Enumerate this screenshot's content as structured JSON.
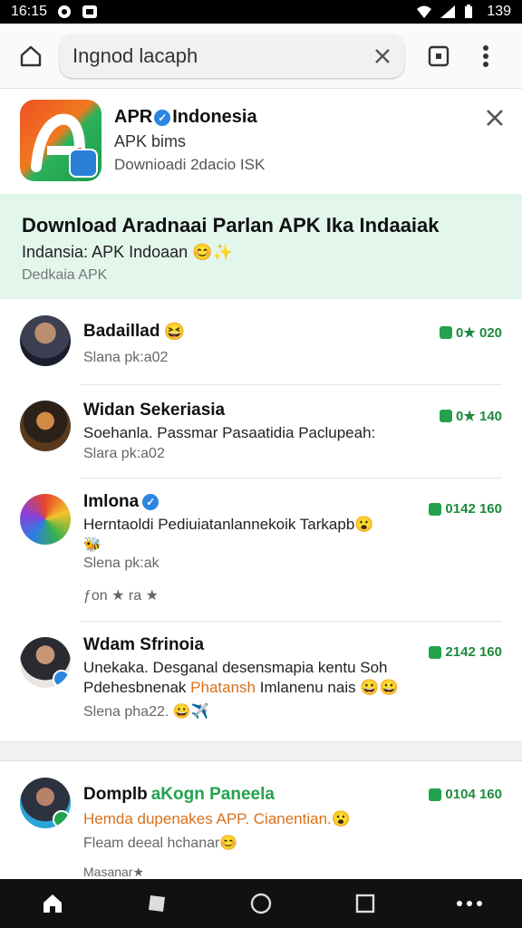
{
  "status_bar": {
    "time": "16:15",
    "battery": "139"
  },
  "toolbar": {
    "url": "Ingnod lacaph"
  },
  "app_header": {
    "title": "APR",
    "title_suffix": "Indonesia",
    "subtitle": "APK bims",
    "downloads": "Downioadi 2dacio ISK"
  },
  "banner": {
    "title": "Download Aradnaai Parlan APK Ika Indaaiak",
    "subtitle": "Indansia: APK Indoaan",
    "caption": "Dedkaia APK"
  },
  "items": [
    {
      "name": "Badaillad",
      "text": "",
      "meta": "Slana pk:a02",
      "score": "0★ 020",
      "extra": ""
    },
    {
      "name": "Widan Sekeriasia",
      "text": "Soehanla. Passmar Pasaatidia Paclupeah:",
      "meta": "Slara pk:a02",
      "score": "0★ 140",
      "extra": ""
    },
    {
      "name": "Imlona",
      "text": "Herntaoldi Pediuiatanlannekoik Tarkapb",
      "meta": "Slena pk:ak",
      "score": "0142 160",
      "extra": "ƒon ★ ra ★"
    },
    {
      "name": "Wdam Sfrinoia",
      "text": "Unekaka. Desganal desensmapia kentu Soh",
      "text2a": "Pdehesbnenak",
      "text2b": "Phatansh",
      "text2c": "Imlanenu nais",
      "meta": "Slena pha22.",
      "score": "2142 160",
      "extra": ""
    },
    {
      "name": "Domplb",
      "name_b": "aKogn Paneela",
      "text": "Hemda dupenakes APP. Cianentian.",
      "meta": "Fleam deeal hchanar",
      "score": "0104 160",
      "extra": "Masanar★"
    }
  ],
  "nav": [
    "home-icon",
    "square-icon",
    "circle-icon",
    "recents-icon",
    "more-icon"
  ],
  "colors": {
    "accent_green": "#23a24d",
    "banner_bg": "#e2f6ec",
    "verified_blue": "#2b86e0",
    "highlight_orange": "#d9711c"
  }
}
